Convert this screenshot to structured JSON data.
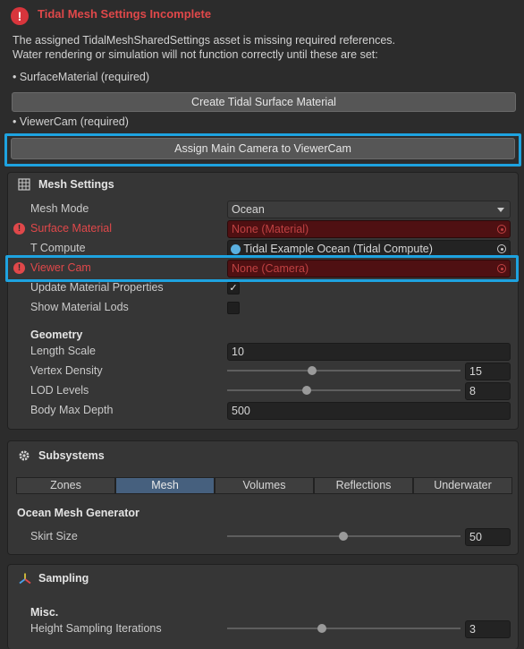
{
  "warning": {
    "title": "Tidal Mesh Settings Incomplete",
    "line1": "The assigned TidalMeshSharedSettings asset is missing required references.",
    "line2": "Water rendering or simulation will not function correctly until these are set:",
    "req1": "• SurfaceMaterial (required)",
    "create_btn": "Create Tidal Surface Material",
    "req2": "• ViewerCam (required)",
    "assign_btn": "Assign Main Camera to ViewerCam"
  },
  "mesh_settings": {
    "header": "Mesh Settings",
    "mesh_mode_label": "Mesh Mode",
    "mesh_mode_value": "Ocean",
    "surface_material_label": "Surface Material",
    "surface_material_value": "None (Material)",
    "t_compute_label": "T Compute",
    "t_compute_value": "Tidal Example Ocean (Tidal Compute)",
    "viewer_cam_label": "Viewer Cam",
    "viewer_cam_value": "None (Camera)",
    "update_props_label": "Update Material Properties",
    "update_props_checked": true,
    "show_lods_label": "Show Material Lods",
    "show_lods_checked": false,
    "geometry_header": "Geometry",
    "length_scale_label": "Length Scale",
    "length_scale_value": "10",
    "vertex_density_label": "Vertex Density",
    "vertex_density_value": "15",
    "lod_levels_label": "LOD Levels",
    "lod_levels_value": "8",
    "body_max_depth_label": "Body Max Depth",
    "body_max_depth_value": "500"
  },
  "subsystems": {
    "header": "Subsystems",
    "tabs": [
      "Zones",
      "Mesh",
      "Volumes",
      "Reflections",
      "Underwater"
    ],
    "active_tab": "Mesh",
    "generator_header": "Ocean Mesh Generator",
    "skirt_label": "Skirt Size",
    "skirt_value": "50"
  },
  "sampling": {
    "header": "Sampling",
    "misc_header": "Misc.",
    "iterations_label": "Height Sampling Iterations",
    "iterations_value": "3"
  },
  "colors": {
    "error": "#e0484a",
    "highlight": "#1ea3e0",
    "active_tab": "#46607e"
  }
}
